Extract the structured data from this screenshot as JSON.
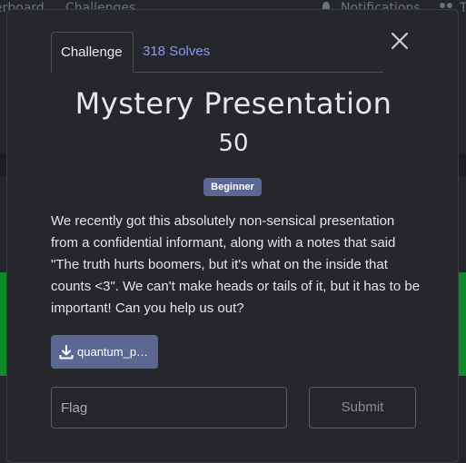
{
  "background": {
    "nav_link_1": "erboard",
    "nav_link_2": "Challenges",
    "notifications_label": "Notifications",
    "partial_label": "T",
    "bell_icon": "bell-icon",
    "users_icon": "users-icon"
  },
  "modal": {
    "close_icon": "close-icon",
    "tabs": [
      {
        "label": "Challenge",
        "active": true
      },
      {
        "label": "318 Solves",
        "active": false
      }
    ],
    "title": "Mystery Presentation",
    "points": "50",
    "category_badge": "Beginner",
    "description": "We recently got this absolutely non-sensical presentation from a confidential informant, along with a notes that said \"The truth hurts boomers, but it's what on the inside that counts <3\". We can't make heads or tails of it, but it has to be important! Can you help us out?",
    "file": {
      "icon": "download-icon",
      "label": "quantum_p…"
    },
    "flag_input": {
      "placeholder": "Flag",
      "value": ""
    },
    "submit_label": "Submit"
  },
  "colors": {
    "accent": "#5c6894",
    "tab_link": "#8b97f0",
    "modal_bg": "#25272b",
    "green_band": "#0d8a2a"
  }
}
